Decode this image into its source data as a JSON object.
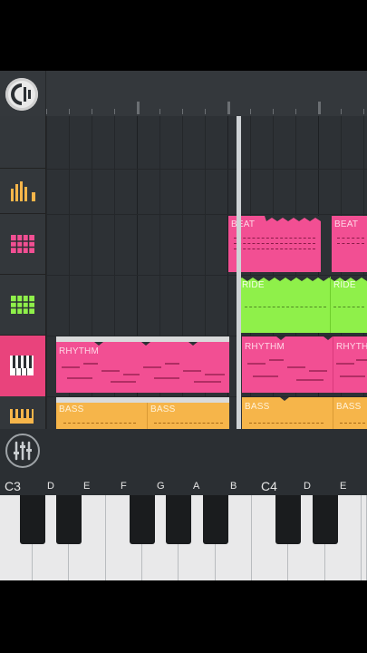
{
  "tracks": [
    {
      "name": "drum-levels",
      "icon": "bars-icon",
      "color": "#f6b54a"
    },
    {
      "name": "beat-pads",
      "icon": "pink-pads-icon",
      "color": "#f24f93"
    },
    {
      "name": "ride-pads",
      "icon": "green-pads-icon",
      "color": "#8ff04a"
    },
    {
      "name": "rhythm-keys",
      "icon": "piano-icon",
      "color": "#ffffff"
    },
    {
      "name": "bass-keys",
      "icon": "bass-keys-icon",
      "color": "#f6b54a"
    }
  ],
  "clips": {
    "beat": [
      "BEAT",
      "BEAT"
    ],
    "ride": [
      "RIDE",
      "RIDE"
    ],
    "rhythm": [
      "RHYTHM",
      "RHYTHM",
      "RHYTHM"
    ],
    "bass": [
      "BASS",
      "BASS",
      "BASS",
      "BASS",
      "BASS"
    ]
  },
  "keyboard": {
    "notes": [
      "C3",
      "D",
      "E",
      "F",
      "G",
      "A",
      "B",
      "C4",
      "D",
      "E"
    ]
  },
  "colors": {
    "pink": "#f24f93",
    "green": "#8ff04a",
    "orange": "#f6b54a",
    "background": "#2b2f33"
  }
}
